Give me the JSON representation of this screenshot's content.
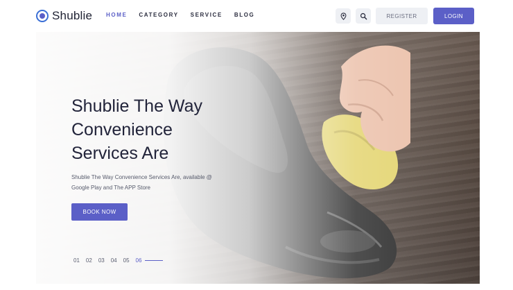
{
  "brand": {
    "name": "Shublie"
  },
  "nav": {
    "items": [
      {
        "label": "HOME",
        "active": true
      },
      {
        "label": "CATEGORY",
        "active": false
      },
      {
        "label": "SERVICE",
        "active": false
      },
      {
        "label": "BLOG",
        "active": false
      }
    ]
  },
  "header": {
    "location_icon": "map-pin-icon",
    "search_icon": "search-icon",
    "register_label": "REGISTER",
    "login_label": "LOGIN"
  },
  "hero": {
    "title": "Shublie The Way Convenience Services Are",
    "subtitle": "Shublie The Way Convenience Services Are, available @ Google Play and The APP Store",
    "cta_label": "BOOK NOW",
    "slides": [
      "01",
      "02",
      "03",
      "04",
      "05",
      "06"
    ],
    "active_slide": "06"
  },
  "colors": {
    "accent": "#5b5fc7",
    "text_dark": "#22243a",
    "button_light": "#eef0f4"
  }
}
